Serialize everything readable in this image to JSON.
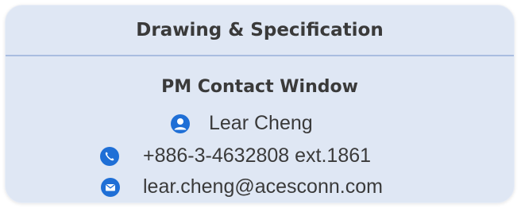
{
  "header": {
    "title": "Drawing & Specification"
  },
  "contact": {
    "title": "PM Contact Window",
    "name": "Lear Cheng",
    "phone": "+886-3-4632808 ext.1861",
    "email": "lear.cheng@acesconn.com"
  },
  "colors": {
    "card_background": "#dfe7f4",
    "divider": "#a9bde0",
    "icon_blue": "#1f6fd6",
    "text": "#3a3a3a"
  },
  "icons": {
    "name": "user-icon",
    "phone": "phone-icon",
    "email": "envelope-icon"
  }
}
